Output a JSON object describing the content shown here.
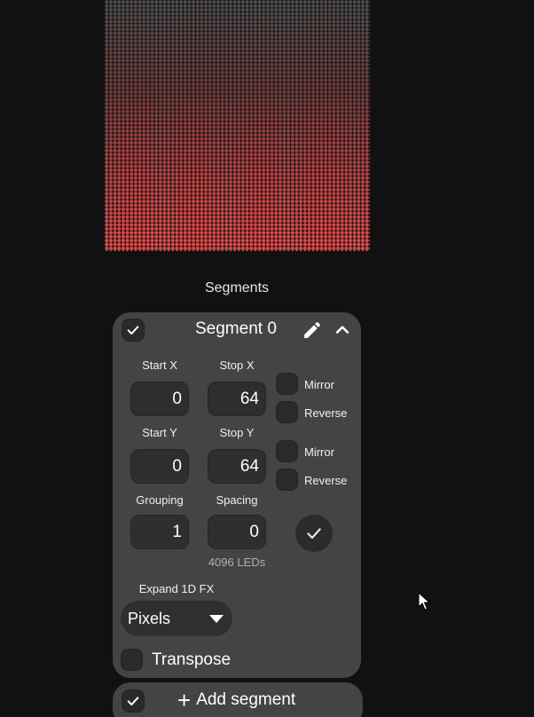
{
  "colors": {
    "background": "#111111",
    "card": "#444444",
    "field": "#2e2e2e",
    "led_top": "#4a4a4a",
    "led_bottom": "#e04848"
  },
  "preview": {
    "icon": "led-matrix-preview"
  },
  "segments": {
    "title": "Segments"
  },
  "segment": {
    "name": "Segment 0",
    "selected": true,
    "icons": {
      "edit": "pencil-icon",
      "collapse": "chevron-up-icon",
      "apply": "check-icon"
    },
    "start_x_label": "Start X",
    "start_x": "0",
    "stop_x_label": "Stop X",
    "stop_x": "64",
    "mirror_x_label": "Mirror",
    "reverse_x_label": "Reverse",
    "start_y_label": "Start Y",
    "start_y": "0",
    "stop_y_label": "Stop Y",
    "stop_y": "64",
    "mirror_y_label": "Mirror",
    "reverse_y_label": "Reverse",
    "grouping_label": "Grouping",
    "grouping": "1",
    "spacing_label": "Spacing",
    "spacing": "0",
    "led_count": "4096 LEDs",
    "expand_label": "Expand 1D FX",
    "expand_value": "Pixels",
    "transpose_label": "Transpose"
  },
  "add_segment": {
    "label": "Add segment",
    "icon": "plus-icon"
  }
}
